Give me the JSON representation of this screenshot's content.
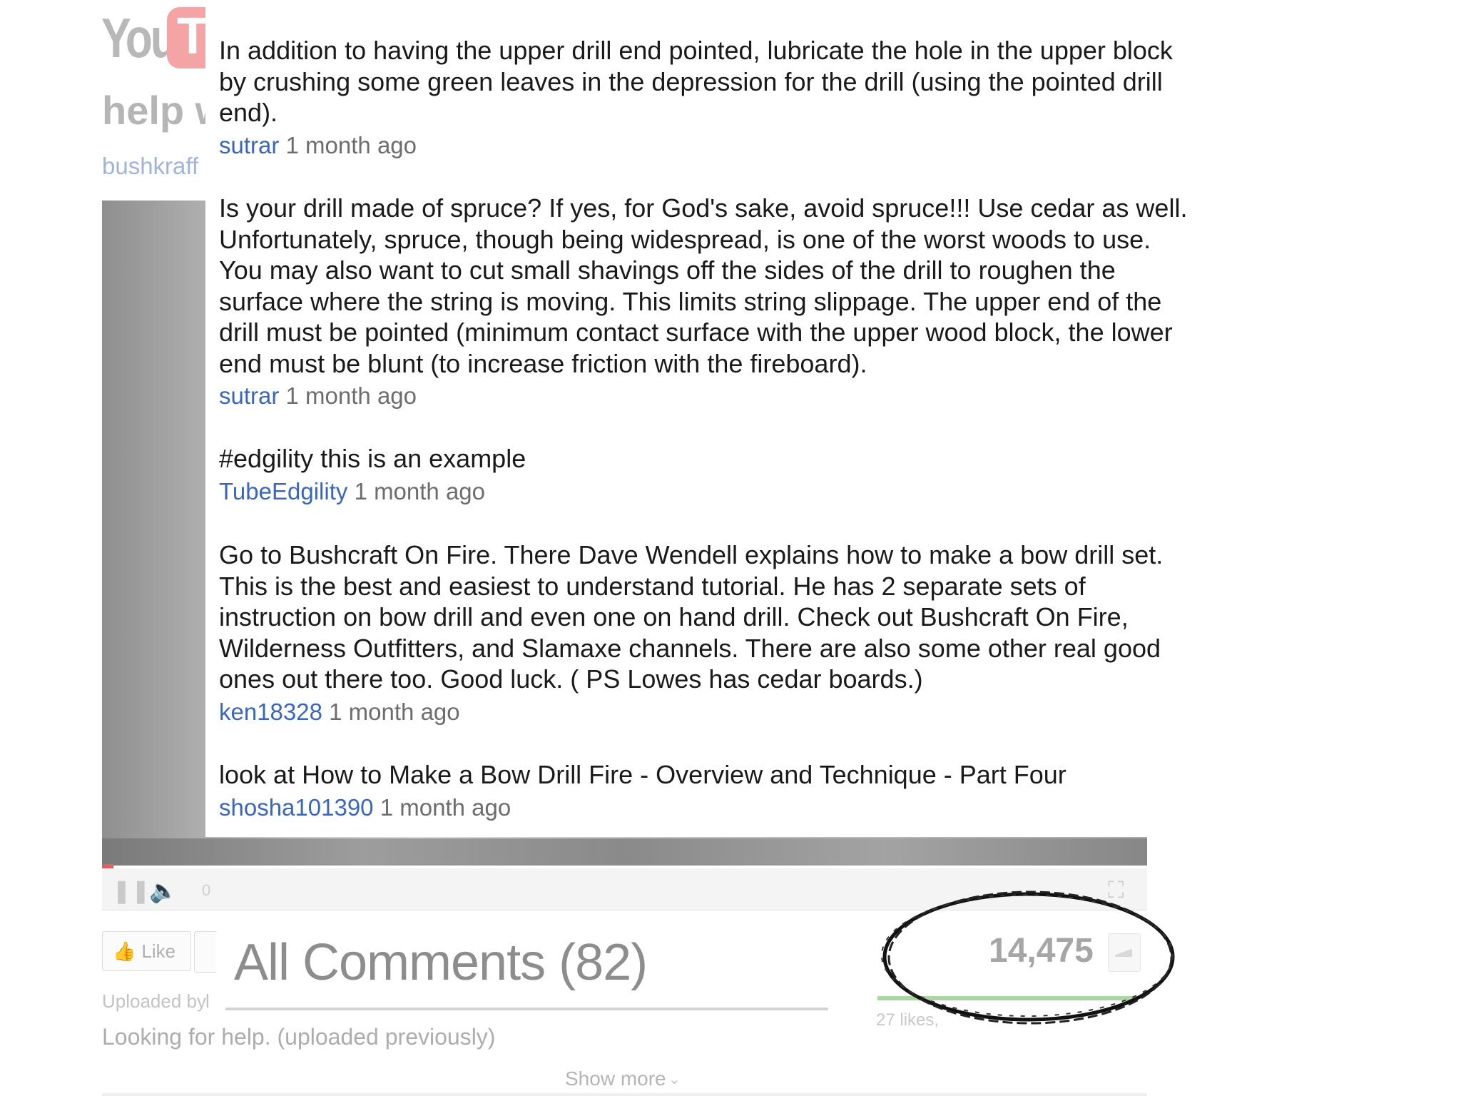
{
  "background_page": {
    "logo": {
      "you": "You",
      "tube": "Tu"
    },
    "video_title_fragment": "help w",
    "channel_fragment": "bushkraff",
    "player": {
      "time_fragment": "0"
    },
    "like_button_label": "Like",
    "uploaded_by_fragment": "Uploaded by",
    "uploaded_by_initial": "l",
    "description": "Looking for help. (uploaded previously)",
    "all_comments_label": "All Comments (82)",
    "view_count": "14,475",
    "likes_fragment": "27 likes,",
    "show_more_label": "Show more"
  },
  "comments": [
    {
      "lines": [
        "In addition to having the upper drill end pointed, lubricate the hole in the upper block",
        "by crushing some green leaves in the depression for the drill (using the pointed drill",
        "end)."
      ],
      "user": "sutrar",
      "time": "1 month ago"
    },
    {
      "lines": [
        "Is your drill made of spruce? If yes, for God's sake, avoid spruce!!! Use cedar as well.",
        "Unfortunately, spruce, though being widespread, is one of the worst woods to use.",
        "You may also want to cut small shavings off the sides of the drill to roughen the",
        "surface where the string is moving. This limits string slippage. The upper end of the",
        "drill must be pointed (minimum contact surface with the upper wood block, the lower",
        "end must be blunt (to increase friction with the fireboard)."
      ],
      "user": "sutrar",
      "time": "1 month ago"
    },
    {
      "lines": [
        "#edgility this is an example"
      ],
      "user": "TubeEdgility",
      "time": "1 month ago"
    },
    {
      "lines": [
        "Go to Bushcraft On Fire. There Dave Wendell explains how to make a bow drill set.",
        "This is the best and easiest to understand tutorial. He has 2 separate sets of",
        "instruction on bow drill and even one on hand drill. Check out Bushcraft On Fire,",
        "Wilderness Outfitters, and Slamaxe channels. There are also some other real good",
        "ones out there too. Good luck. ( PS Lowes has cedar boards.)"
      ],
      "user": "ken18328",
      "time": "1 month ago"
    },
    {
      "lines": [
        "look at How to Make a Bow Drill Fire - Overview and Technique - Part Four"
      ],
      "user": "shosha101390",
      "time": "1 month ago"
    }
  ],
  "colors": {
    "username_link": "#3a67bd",
    "timestamp": "#6d6d6d",
    "comment_text": "#1a1a1a",
    "like_bar": "#a9d6a2"
  }
}
